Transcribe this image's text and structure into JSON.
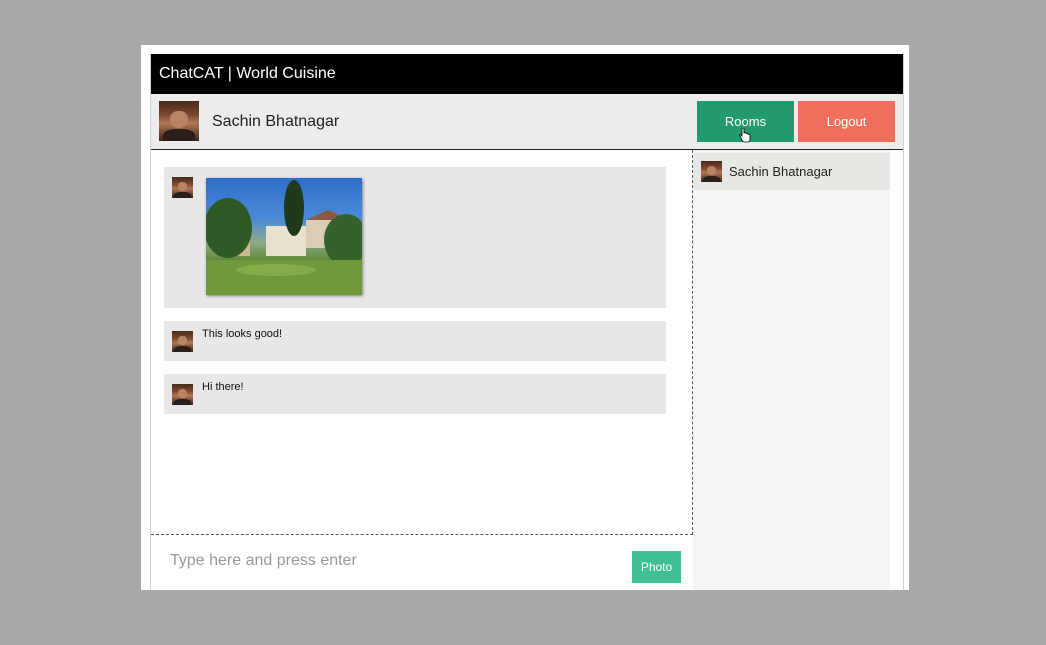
{
  "app": {
    "title": "ChatCAT | World Cuisine"
  },
  "user": {
    "name": "Sachin Bhatnagar"
  },
  "header_buttons": {
    "rooms_label": "Rooms",
    "logout_label": "Logout"
  },
  "messages": [
    {
      "type": "photo",
      "text": ""
    },
    {
      "type": "text",
      "text": "This looks good!"
    },
    {
      "type": "text",
      "text": "Hi there!"
    }
  ],
  "input": {
    "placeholder": "Type here and press enter",
    "photo_label": "Photo"
  },
  "users_list": [
    {
      "name": "Sachin Bhatnagar"
    }
  ],
  "colors": {
    "rooms": "#23996e",
    "logout": "#ef6f5c",
    "photo": "#3fbf95"
  }
}
